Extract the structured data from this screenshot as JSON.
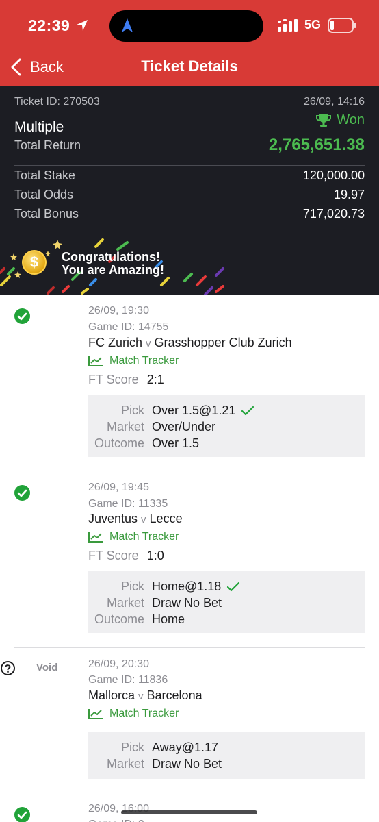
{
  "status_bar": {
    "time": "22:39",
    "network": "5G",
    "icons": [
      "location-arrow-icon",
      "signal-icon",
      "battery-icon"
    ]
  },
  "nav": {
    "back_label": "Back",
    "title": "Ticket Details"
  },
  "summary": {
    "ticket_id": "Ticket ID: 270503",
    "date": "26/09, 14:16",
    "bet_type": "Multiple",
    "status": "Won",
    "total_return_label": "Total Return",
    "total_return_value": "2,765,651.38",
    "rows": [
      {
        "label": "Total Stake",
        "value": "120,000.00"
      },
      {
        "label": "Total Odds",
        "value": "19.97"
      },
      {
        "label": "Total Bonus",
        "value": "717,020.73"
      }
    ],
    "banner_line1": "Congratulations!",
    "banner_line2": "You are Amazing!"
  },
  "colors": {
    "brand_red": "#d83a36",
    "won_green": "#4cbb50",
    "dark_bg": "#1c1d23"
  },
  "selections": [
    {
      "status": "won",
      "date": "26/09, 19:30",
      "game_id": "Game ID: 14755",
      "home": "FC Zurich",
      "vs": "v",
      "away": "Grasshopper Club Zurich",
      "tracker": "Match Tracker",
      "ft_label": "FT Score",
      "ft_value": "2:1",
      "pick_label": "Pick",
      "pick": "Over 1.5@1.21",
      "market_label": "Market",
      "market": "Over/Under",
      "outcome_label": "Outcome",
      "outcome": "Over 1.5"
    },
    {
      "status": "won",
      "date": "26/09, 19:45",
      "game_id": "Game ID: 11335",
      "home": "Juventus",
      "vs": "v",
      "away": "Lecce",
      "tracker": "Match Tracker",
      "ft_label": "FT Score",
      "ft_value": "1:0",
      "pick_label": "Pick",
      "pick": "Home@1.18",
      "market_label": "Market",
      "market": "Draw No Bet",
      "outcome_label": "Outcome",
      "outcome": "Home"
    },
    {
      "status": "void",
      "void_label": "Void",
      "date": "26/09, 20:30",
      "game_id": "Game ID: 11836",
      "home": "Mallorca",
      "vs": "v",
      "away": "Barcelona",
      "tracker": "Match Tracker",
      "pick_label": "Pick",
      "pick": "Away@1.17",
      "market_label": "Market",
      "market": "Draw No Bet"
    },
    {
      "status": "won",
      "date": "26/09, 16:00",
      "game_id": "Game ID: 2"
    }
  ]
}
